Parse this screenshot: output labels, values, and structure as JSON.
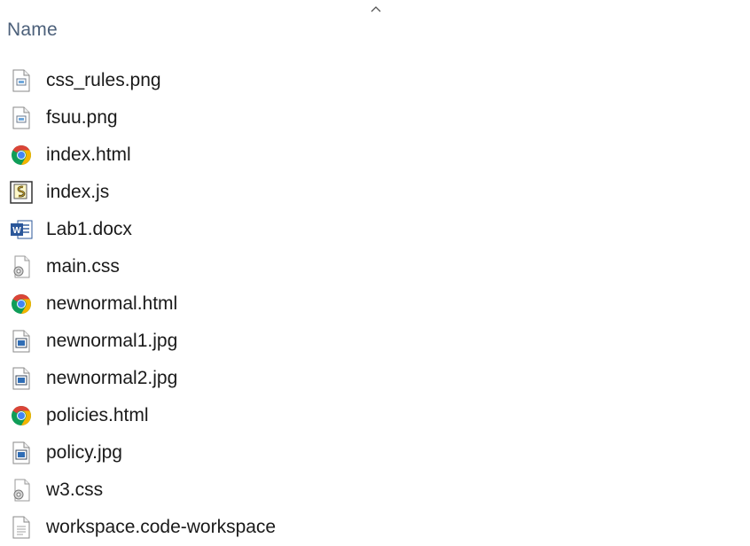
{
  "header": {
    "name_column": "Name",
    "sort_indicator_icon": "chevron-up-icon"
  },
  "files": [
    {
      "name": "css_rules.png",
      "icon": "image-file-icon"
    },
    {
      "name": "fsuu.png",
      "icon": "image-file-icon"
    },
    {
      "name": "index.html",
      "icon": "chrome-html-icon"
    },
    {
      "name": "index.js",
      "icon": "script-file-icon"
    },
    {
      "name": "Lab1.docx",
      "icon": "word-document-icon"
    },
    {
      "name": "main.css",
      "icon": "css-file-icon"
    },
    {
      "name": "newnormal.html",
      "icon": "chrome-html-icon"
    },
    {
      "name": "newnormal1.jpg",
      "icon": "jpg-file-icon"
    },
    {
      "name": "newnormal2.jpg",
      "icon": "jpg-file-icon"
    },
    {
      "name": "policies.html",
      "icon": "chrome-html-icon"
    },
    {
      "name": "policy.jpg",
      "icon": "jpg-file-icon"
    },
    {
      "name": "w3.css",
      "icon": "css-file-icon"
    },
    {
      "name": "workspace.code-workspace",
      "icon": "generic-file-icon"
    }
  ],
  "colors": {
    "header_text": "#4c607a",
    "file_text": "#1a1a1a",
    "word_blue": "#2b579a",
    "chrome_red": "#db4437",
    "chrome_yellow": "#f4b400",
    "chrome_green": "#0f9d58",
    "chrome_blue": "#4285f4"
  }
}
